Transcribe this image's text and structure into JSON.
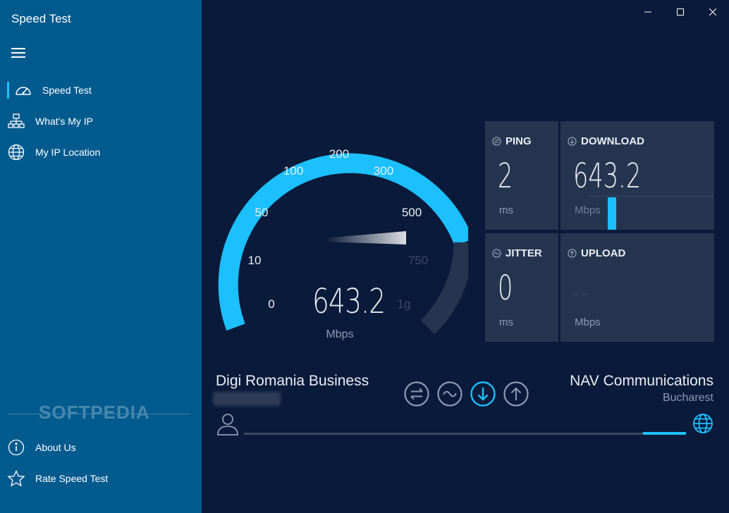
{
  "app": {
    "title": "Speed Test"
  },
  "sidebar": {
    "items": [
      {
        "label": "Speed Test",
        "icon": "speedometer-icon"
      },
      {
        "label": "What's My IP",
        "icon": "network-icon"
      },
      {
        "label": "My IP Location",
        "icon": "globe-icon"
      }
    ],
    "footer": [
      {
        "label": "About Us",
        "icon": "info-icon"
      },
      {
        "label": "Rate Speed Test",
        "icon": "star-icon"
      }
    ],
    "watermark": "SOFTPEDIA"
  },
  "gauge": {
    "ticks": [
      "0",
      "10",
      "50",
      "100",
      "200",
      "300",
      "500",
      "750",
      "1g"
    ],
    "value": "643.2",
    "unit": "Mbps",
    "accent_color": "#1cc0ff"
  },
  "stats": {
    "ping": {
      "label": "PING",
      "value": "2",
      "unit": "ms"
    },
    "download": {
      "label": "DOWNLOAD",
      "value": "643.2",
      "unit": "Mbps"
    },
    "jitter": {
      "label": "JITTER",
      "value": "0",
      "unit": "ms"
    },
    "upload": {
      "label": "UPLOAD",
      "value": "– –",
      "unit": "Mbps"
    }
  },
  "connection": {
    "isp": "Digi Romania Business",
    "server_name": "NAV Communications",
    "server_location": "Bucharest"
  },
  "colors": {
    "sidebar": "#035a8e",
    "background": "#0a1a3a",
    "card": "#26354f",
    "accent": "#1cc0ff"
  }
}
